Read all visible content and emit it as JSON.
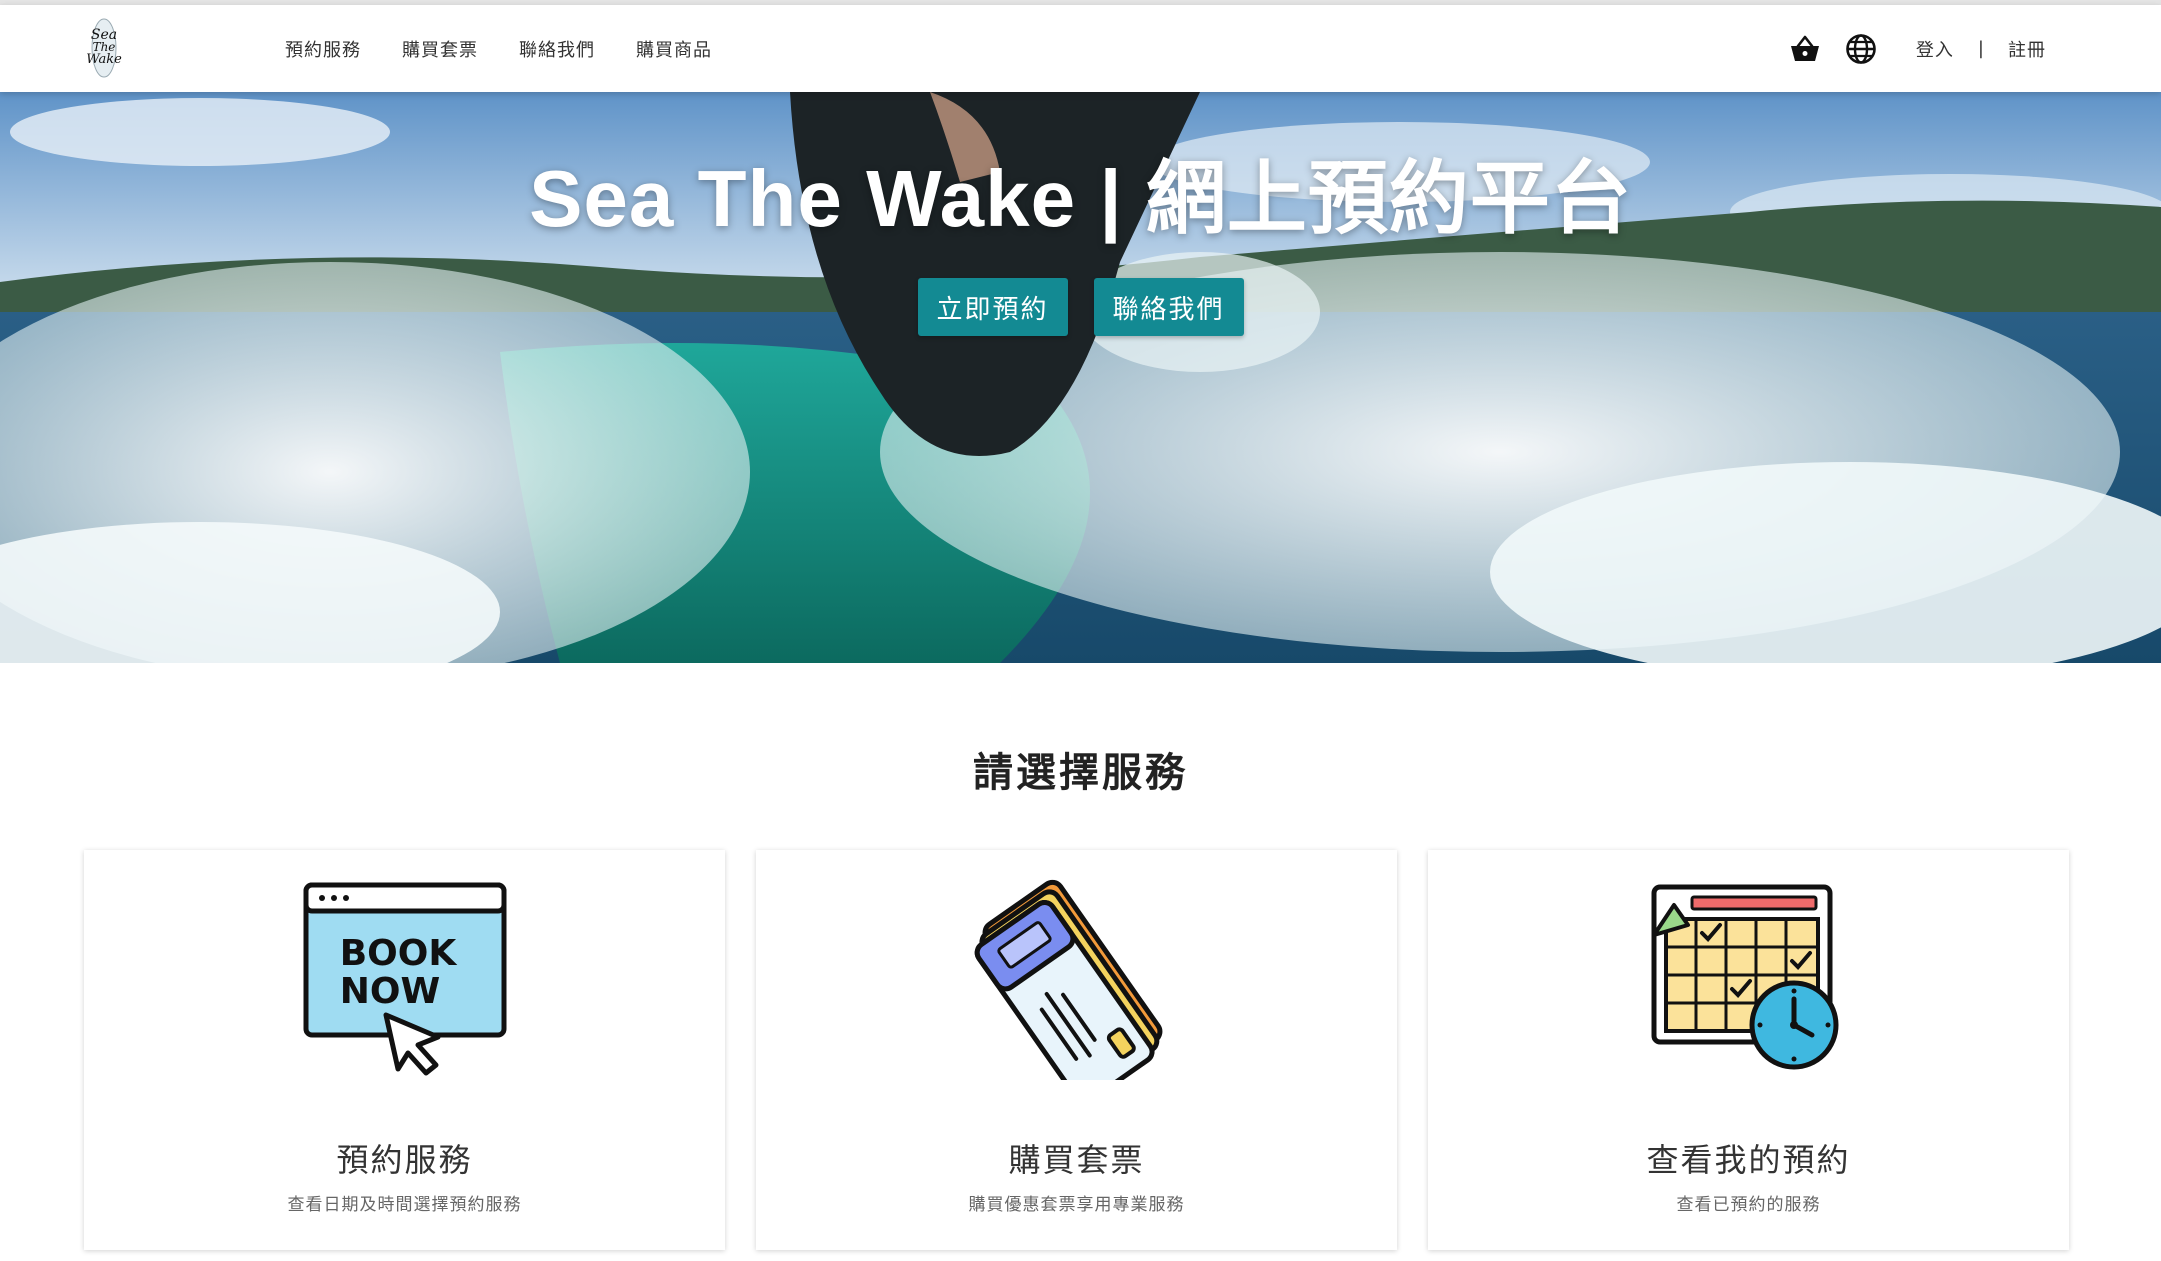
{
  "brand": {
    "logo_name": "Sea The Wake"
  },
  "nav": {
    "items": [
      "預約服務",
      "購買套票",
      "聯絡我們",
      "購買商品"
    ]
  },
  "header": {
    "login_label": "登入",
    "separator": "|",
    "register_label": "註冊",
    "icons": [
      "basket-icon",
      "globe-icon"
    ]
  },
  "hero": {
    "title": "Sea The Wake | 網上預約平台",
    "book_button": "立即預約",
    "contact_button": "聯絡我們"
  },
  "section": {
    "title": "請選擇服務"
  },
  "cards": [
    {
      "title": "預約服務",
      "desc": "查看日期及時間選擇預約服務",
      "icon": "book-now-icon",
      "icon_text_line1": "BOOK",
      "icon_text_line2": "NOW"
    },
    {
      "title": "購買套票",
      "desc": "購買優惠套票享用專業服務",
      "icon": "tickets-icon"
    },
    {
      "title": "查看我的預約",
      "desc": "查看已預約的服務",
      "icon": "calendar-clock-icon"
    }
  ],
  "colors": {
    "accent": "#138a93",
    "text": "#333333"
  }
}
